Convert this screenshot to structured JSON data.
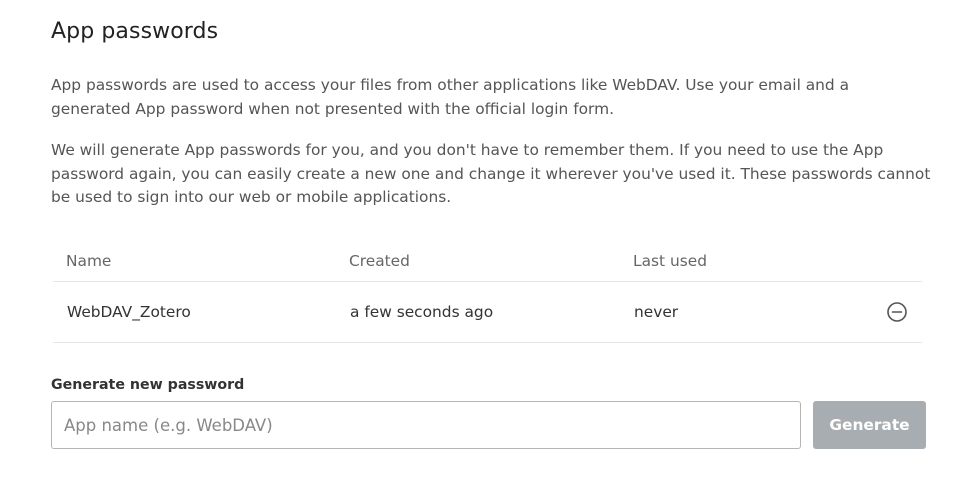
{
  "section": {
    "title": "App passwords",
    "description_1": "App passwords are used to access your files from other applications like WebDAV. Use your email and a generated App password when not presented with the official login form.",
    "description_2": "We will generate App passwords for you, and you don't have to remember them. If you need to use the App password again, you can easily create a new one and change it wherever you've used it. These passwords cannot be used to sign into our web or mobile applications."
  },
  "table": {
    "headers": {
      "name": "Name",
      "created": "Created",
      "last_used": "Last used"
    },
    "rows": [
      {
        "name": "WebDAV_Zotero",
        "created": "a few seconds ago",
        "last_used": "never",
        "action_icon": "minus-circle-icon"
      }
    ]
  },
  "generate": {
    "label": "Generate new password",
    "input_value": "",
    "input_placeholder": "App name (e.g. WebDAV)",
    "button_label": "Generate",
    "button_color": "#a8adb1",
    "button_enabled": false
  }
}
